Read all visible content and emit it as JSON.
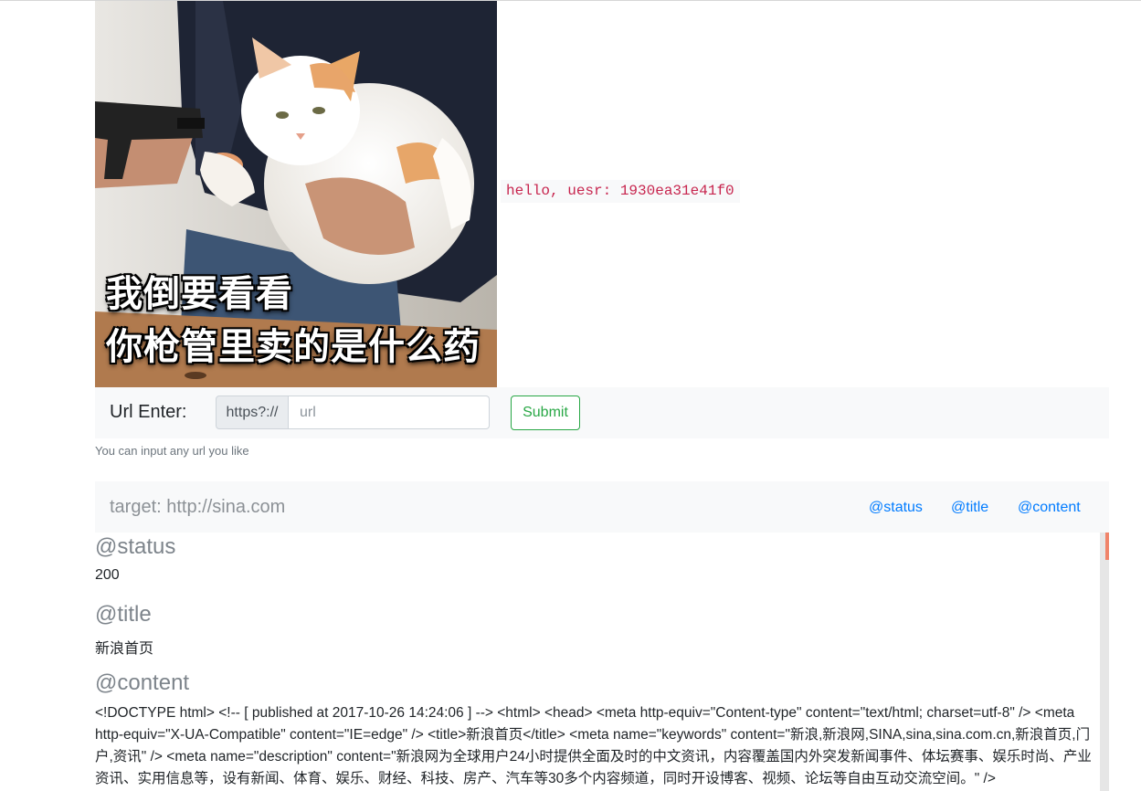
{
  "meme": {
    "caption_line1": "我倒要看看",
    "caption_line2": "你枪管里卖的是什么药"
  },
  "greeting": "hello, uesr: 1930ea31e41f0",
  "form": {
    "label": "Url Enter:",
    "protocol_addon": "https?://",
    "url_placeholder": "url",
    "submit_label": "Submit",
    "help_text": "You can input any url you like"
  },
  "nav": {
    "target": "target: http://sina.com",
    "links": [
      "@status",
      "@title",
      "@content"
    ]
  },
  "result": {
    "status_heading": "@status",
    "status_value": "200",
    "title_heading": "@title",
    "title_value": "新浪首页",
    "content_heading": "@content",
    "content_value": "<!DOCTYPE html> <!-- [ published at 2017-10-26 14:24:06 ] --> <html> <head> <meta http-equiv=\"Content-type\" content=\"text/html; charset=utf-8\" /> <meta http-equiv=\"X-UA-Compatible\" content=\"IE=edge\" /> <title>新浪首页</title> <meta name=\"keywords\" content=\"新浪,新浪网,SINA,sina,sina.com.cn,新浪首页,门户,资讯\" /> <meta name=\"description\" content=\"新浪网为全球用户24小时提供全面及时的中文资讯，内容覆盖国内外突发新闻事件、体坛赛事、娱乐时尚、产业资讯、实用信息等，设有新闻、体育、娱乐、财经、科技、房产、汽车等30多个内容频道，同时开设博客、视频、论坛等自由互动交流空间。\" />"
  },
  "colors": {
    "accent_link": "#007bff",
    "submit_green": "#28a745",
    "greeting_code": "#c7254e",
    "scroll_thumb": "#f0846a"
  }
}
